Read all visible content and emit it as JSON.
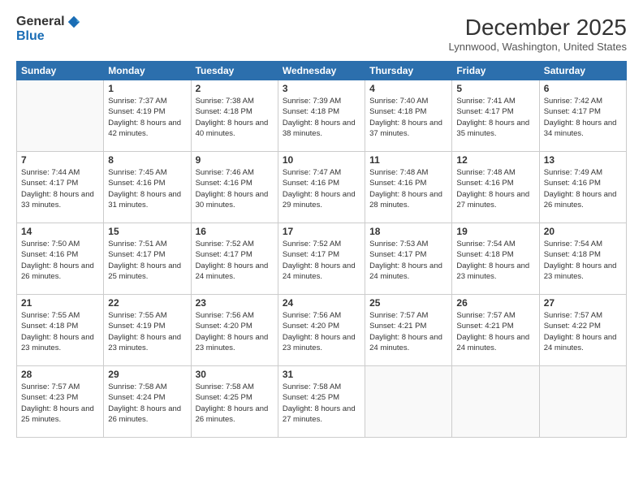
{
  "header": {
    "logo_general": "General",
    "logo_blue": "Blue",
    "month_title": "December 2025",
    "location": "Lynnwood, Washington, United States"
  },
  "weekdays": [
    "Sunday",
    "Monday",
    "Tuesday",
    "Wednesday",
    "Thursday",
    "Friday",
    "Saturday"
  ],
  "weeks": [
    [
      {
        "day": "",
        "sunrise": "",
        "sunset": "",
        "daylight": ""
      },
      {
        "day": "1",
        "sunrise": "Sunrise: 7:37 AM",
        "sunset": "Sunset: 4:19 PM",
        "daylight": "Daylight: 8 hours and 42 minutes."
      },
      {
        "day": "2",
        "sunrise": "Sunrise: 7:38 AM",
        "sunset": "Sunset: 4:18 PM",
        "daylight": "Daylight: 8 hours and 40 minutes."
      },
      {
        "day": "3",
        "sunrise": "Sunrise: 7:39 AM",
        "sunset": "Sunset: 4:18 PM",
        "daylight": "Daylight: 8 hours and 38 minutes."
      },
      {
        "day": "4",
        "sunrise": "Sunrise: 7:40 AM",
        "sunset": "Sunset: 4:18 PM",
        "daylight": "Daylight: 8 hours and 37 minutes."
      },
      {
        "day": "5",
        "sunrise": "Sunrise: 7:41 AM",
        "sunset": "Sunset: 4:17 PM",
        "daylight": "Daylight: 8 hours and 35 minutes."
      },
      {
        "day": "6",
        "sunrise": "Sunrise: 7:42 AM",
        "sunset": "Sunset: 4:17 PM",
        "daylight": "Daylight: 8 hours and 34 minutes."
      }
    ],
    [
      {
        "day": "7",
        "sunrise": "Sunrise: 7:44 AM",
        "sunset": "Sunset: 4:17 PM",
        "daylight": "Daylight: 8 hours and 33 minutes."
      },
      {
        "day": "8",
        "sunrise": "Sunrise: 7:45 AM",
        "sunset": "Sunset: 4:16 PM",
        "daylight": "Daylight: 8 hours and 31 minutes."
      },
      {
        "day": "9",
        "sunrise": "Sunrise: 7:46 AM",
        "sunset": "Sunset: 4:16 PM",
        "daylight": "Daylight: 8 hours and 30 minutes."
      },
      {
        "day": "10",
        "sunrise": "Sunrise: 7:47 AM",
        "sunset": "Sunset: 4:16 PM",
        "daylight": "Daylight: 8 hours and 29 minutes."
      },
      {
        "day": "11",
        "sunrise": "Sunrise: 7:48 AM",
        "sunset": "Sunset: 4:16 PM",
        "daylight": "Daylight: 8 hours and 28 minutes."
      },
      {
        "day": "12",
        "sunrise": "Sunrise: 7:48 AM",
        "sunset": "Sunset: 4:16 PM",
        "daylight": "Daylight: 8 hours and 27 minutes."
      },
      {
        "day": "13",
        "sunrise": "Sunrise: 7:49 AM",
        "sunset": "Sunset: 4:16 PM",
        "daylight": "Daylight: 8 hours and 26 minutes."
      }
    ],
    [
      {
        "day": "14",
        "sunrise": "Sunrise: 7:50 AM",
        "sunset": "Sunset: 4:16 PM",
        "daylight": "Daylight: 8 hours and 26 minutes."
      },
      {
        "day": "15",
        "sunrise": "Sunrise: 7:51 AM",
        "sunset": "Sunset: 4:17 PM",
        "daylight": "Daylight: 8 hours and 25 minutes."
      },
      {
        "day": "16",
        "sunrise": "Sunrise: 7:52 AM",
        "sunset": "Sunset: 4:17 PM",
        "daylight": "Daylight: 8 hours and 24 minutes."
      },
      {
        "day": "17",
        "sunrise": "Sunrise: 7:52 AM",
        "sunset": "Sunset: 4:17 PM",
        "daylight": "Daylight: 8 hours and 24 minutes."
      },
      {
        "day": "18",
        "sunrise": "Sunrise: 7:53 AM",
        "sunset": "Sunset: 4:17 PM",
        "daylight": "Daylight: 8 hours and 24 minutes."
      },
      {
        "day": "19",
        "sunrise": "Sunrise: 7:54 AM",
        "sunset": "Sunset: 4:18 PM",
        "daylight": "Daylight: 8 hours and 23 minutes."
      },
      {
        "day": "20",
        "sunrise": "Sunrise: 7:54 AM",
        "sunset": "Sunset: 4:18 PM",
        "daylight": "Daylight: 8 hours and 23 minutes."
      }
    ],
    [
      {
        "day": "21",
        "sunrise": "Sunrise: 7:55 AM",
        "sunset": "Sunset: 4:18 PM",
        "daylight": "Daylight: 8 hours and 23 minutes."
      },
      {
        "day": "22",
        "sunrise": "Sunrise: 7:55 AM",
        "sunset": "Sunset: 4:19 PM",
        "daylight": "Daylight: 8 hours and 23 minutes."
      },
      {
        "day": "23",
        "sunrise": "Sunrise: 7:56 AM",
        "sunset": "Sunset: 4:20 PM",
        "daylight": "Daylight: 8 hours and 23 minutes."
      },
      {
        "day": "24",
        "sunrise": "Sunrise: 7:56 AM",
        "sunset": "Sunset: 4:20 PM",
        "daylight": "Daylight: 8 hours and 23 minutes."
      },
      {
        "day": "25",
        "sunrise": "Sunrise: 7:57 AM",
        "sunset": "Sunset: 4:21 PM",
        "daylight": "Daylight: 8 hours and 24 minutes."
      },
      {
        "day": "26",
        "sunrise": "Sunrise: 7:57 AM",
        "sunset": "Sunset: 4:21 PM",
        "daylight": "Daylight: 8 hours and 24 minutes."
      },
      {
        "day": "27",
        "sunrise": "Sunrise: 7:57 AM",
        "sunset": "Sunset: 4:22 PM",
        "daylight": "Daylight: 8 hours and 24 minutes."
      }
    ],
    [
      {
        "day": "28",
        "sunrise": "Sunrise: 7:57 AM",
        "sunset": "Sunset: 4:23 PM",
        "daylight": "Daylight: 8 hours and 25 minutes."
      },
      {
        "day": "29",
        "sunrise": "Sunrise: 7:58 AM",
        "sunset": "Sunset: 4:24 PM",
        "daylight": "Daylight: 8 hours and 26 minutes."
      },
      {
        "day": "30",
        "sunrise": "Sunrise: 7:58 AM",
        "sunset": "Sunset: 4:25 PM",
        "daylight": "Daylight: 8 hours and 26 minutes."
      },
      {
        "day": "31",
        "sunrise": "Sunrise: 7:58 AM",
        "sunset": "Sunset: 4:25 PM",
        "daylight": "Daylight: 8 hours and 27 minutes."
      },
      {
        "day": "",
        "sunrise": "",
        "sunset": "",
        "daylight": ""
      },
      {
        "day": "",
        "sunrise": "",
        "sunset": "",
        "daylight": ""
      },
      {
        "day": "",
        "sunrise": "",
        "sunset": "",
        "daylight": ""
      }
    ]
  ]
}
